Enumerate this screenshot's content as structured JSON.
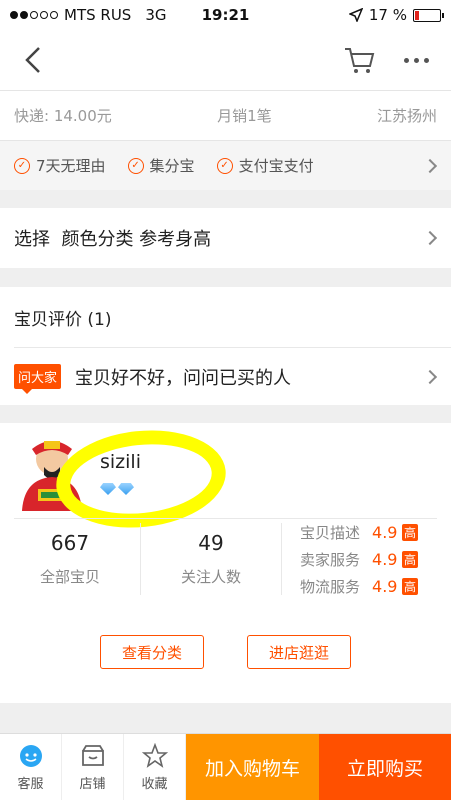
{
  "status": {
    "carrier": "MTS RUS",
    "network": "3G",
    "time": "19:21",
    "battery": "17 %",
    "battery_level": 0.17
  },
  "nav": {
    "back": "back-icon",
    "cart": "cart-icon",
    "more": "more-icon"
  },
  "info": {
    "shipping": "快递: 14.00元",
    "monthly_sales": "月销1笔",
    "location": "江苏扬州"
  },
  "services": [
    "7天无理由",
    "集分宝",
    "支付宝支付"
  ],
  "select": {
    "label": "选择  颜色分类 参考身高"
  },
  "reviews": {
    "title": "宝贝评价 (1)",
    "ask_tag": "问大家",
    "ask_text": "宝贝好不好，问问已买的人"
  },
  "shop": {
    "name": "sizili",
    "stats": [
      {
        "value": "667",
        "label": "全部宝贝"
      },
      {
        "value": "49",
        "label": "关注人数"
      }
    ],
    "ratings": [
      {
        "label": "宝贝描述",
        "score": "4.9",
        "tag": "高"
      },
      {
        "label": "卖家服务",
        "score": "4.9",
        "tag": "高"
      },
      {
        "label": "物流服务",
        "score": "4.9",
        "tag": "高"
      }
    ],
    "buttons": {
      "category": "查看分类",
      "visit": "进店逛逛"
    }
  },
  "bottom": {
    "service": "客服",
    "store": "店铺",
    "favorite": "收藏",
    "add_cart": "加入购物车",
    "buy_now": "立即购买"
  },
  "colors": {
    "accent": "#ff5000",
    "cart": "#ff9500",
    "highlight": "#ffff00"
  }
}
